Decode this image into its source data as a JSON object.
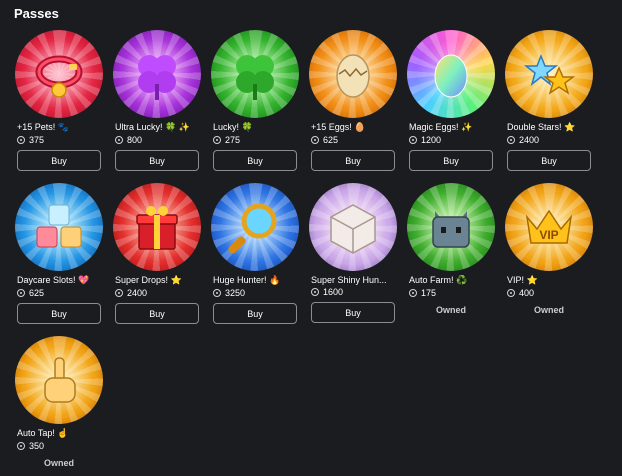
{
  "section_title": "Passes",
  "passes": [
    {
      "name": "+15 Pets! 🐾",
      "price": "375",
      "action": "Buy"
    },
    {
      "name": "Ultra Lucky! 🍀 ✨",
      "price": "800",
      "action": "Buy"
    },
    {
      "name": "Lucky! 🍀",
      "price": "275",
      "action": "Buy"
    },
    {
      "name": "+15 Eggs! 🥚",
      "price": "625",
      "action": "Buy"
    },
    {
      "name": "Magic Eggs! ✨",
      "price": "1200",
      "action": "Buy"
    },
    {
      "name": "Double Stars! ⭐",
      "price": "2400",
      "action": "Buy"
    },
    {
      "name": "Daycare Slots! 💖",
      "price": "625",
      "action": "Buy"
    },
    {
      "name": "Super Drops! ⭐",
      "price": "2400",
      "action": "Buy"
    },
    {
      "name": "Huge Hunter! 🔥",
      "price": "3250",
      "action": "Buy"
    },
    {
      "name": "Super Shiny Hun...",
      "price": "1600",
      "action": "Buy"
    },
    {
      "name": "Auto Farm! ♻️",
      "price": "175",
      "action": "Owned"
    },
    {
      "name": "VIP! ⭐",
      "price": "400",
      "action": "Owned"
    },
    {
      "name": "Auto Tap! ☝️",
      "price": "350",
      "action": "Owned"
    }
  ],
  "colors": {
    "background": "#1b1c1f",
    "button_border": "#8a8d93",
    "owned_text": "#c9ccd1"
  }
}
